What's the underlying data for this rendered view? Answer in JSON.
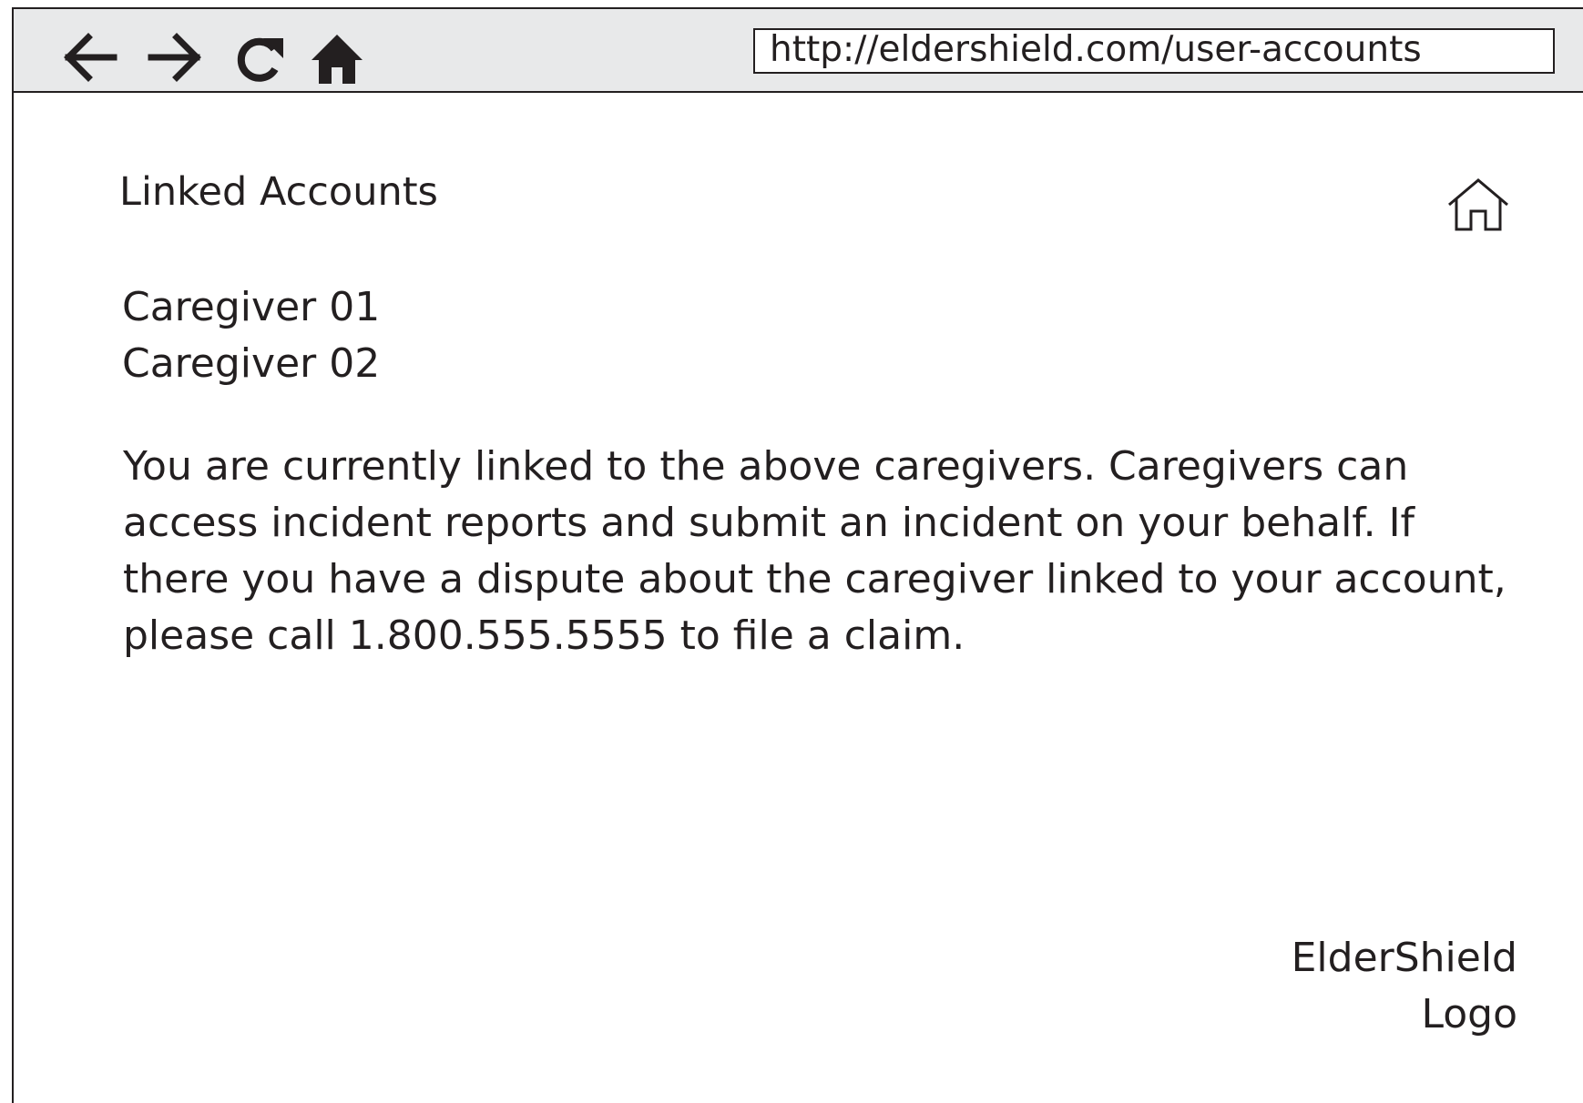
{
  "browser": {
    "url": "http://eldershield.com/user-accounts",
    "icons": {
      "back": "arrow-left-icon",
      "forward": "arrow-right-icon",
      "reload": "reload-icon",
      "home": "home-icon"
    }
  },
  "page": {
    "title": "Linked Accounts",
    "home_icon": "home-outline-icon",
    "caregivers": [
      "Caregiver 01",
      "Caregiver 02"
    ],
    "info_text": "You are currently linked to the above caregivers. Caregivers can access incident reports and submit an incident on your behalf. If there you have a dispute about the caregiver linked to your account, please call 1.800.555.5555 to file a claim."
  },
  "logo": {
    "line1": "ElderShield",
    "line2": "Logo"
  },
  "colors": {
    "ink": "#231f20",
    "toolbar_bg": "#e8e9ea",
    "page_bg": "#ffffff"
  }
}
